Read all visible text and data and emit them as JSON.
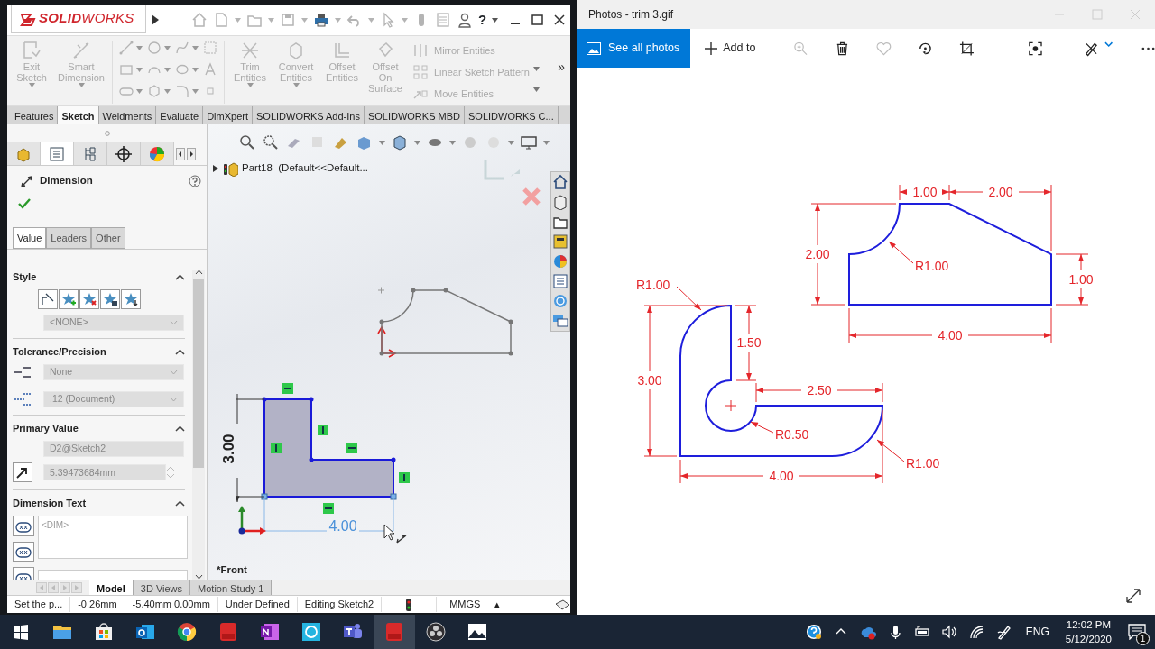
{
  "solidworks": {
    "logo": "**SOLID**WORKS",
    "help": "?",
    "left_commands": [
      {
        "label": "Exit Sketch",
        "disabled": true
      },
      {
        "label": "Smart Dimension",
        "disabled": true
      }
    ],
    "right_commands": [
      {
        "label": "Trim Entities",
        "disabled": true
      },
      {
        "label": "Convert Entities",
        "disabled": true
      },
      {
        "label": "Offset Entities",
        "disabled": true
      },
      {
        "label": "Offset On Surface",
        "disabled": true
      }
    ],
    "list_commands": [
      {
        "label": "Mirror Entities",
        "disabled": true
      },
      {
        "label": "Linear Sketch Pattern",
        "disabled": true
      },
      {
        "label": "Move Entities",
        "disabled": true
      }
    ],
    "more": "»",
    "ribbon_tabs": [
      {
        "label": "Features",
        "selected": false
      },
      {
        "label": "Sketch",
        "selected": true
      },
      {
        "label": "Weldments",
        "selected": false
      },
      {
        "label": "Evaluate",
        "selected": false
      },
      {
        "label": "DimXpert",
        "selected": false
      },
      {
        "label": "SOLIDWORKS Add-Ins",
        "selected": false
      },
      {
        "label": "SOLIDWORKS MBD",
        "selected": false
      },
      {
        "label": "SOLIDWORKS C...",
        "selected": false
      }
    ],
    "panel_tabs": [
      {
        "kind": "feature-tree",
        "selected": false
      },
      {
        "kind": "properties",
        "selected": true
      },
      {
        "kind": "configurations",
        "selected": false
      },
      {
        "kind": "dimxpert",
        "selected": false
      },
      {
        "kind": "appearance",
        "selected": false
      }
    ],
    "manager": {
      "title": "Dimension",
      "tabs": [
        {
          "label": "Value",
          "selected": true
        },
        {
          "label": "Leaders",
          "selected": false
        },
        {
          "label": "Other",
          "selected": false
        }
      ],
      "style": {
        "heading": "Style",
        "dropdown": "<NONE>"
      },
      "tolerance": {
        "heading": "Tolerance/Precision",
        "tolerance": "None",
        "precision": ".12 (Document)"
      },
      "primary": {
        "heading": "Primary Value",
        "name": "D2@Sketch2",
        "value": "5.39473684mm"
      },
      "text": {
        "heading": "Dimension Text",
        "template": "<DIM>"
      }
    },
    "tree_item": "Part18  (Default<<Default...",
    "sketch_dimensions": [
      "3.00",
      "4.00"
    ],
    "view_name": "*Front",
    "bottom_tabs": [
      {
        "label": "Model",
        "selected": true
      },
      {
        "label": "3D Views",
        "selected": false
      },
      {
        "label": "Motion Study 1",
        "selected": false
      }
    ],
    "status": [
      "Set the p...",
      "-0.26mm",
      "-5.40mm  0.00mm",
      "Under Defined",
      "Editing Sketch2",
      "MMGS",
      "▴"
    ]
  },
  "photos": {
    "title": "Photos - trim 3.gif",
    "see_all": "See all photos",
    "add_to": "Add to",
    "tools": [
      {
        "kind": "zoom",
        "disabled": true
      },
      {
        "kind": "delete",
        "disabled": false
      },
      {
        "kind": "favorite",
        "disabled": true
      },
      {
        "kind": "rotate",
        "disabled": false
      },
      {
        "kind": "crop",
        "disabled": false
      },
      {
        "kind": "capture",
        "disabled": false
      },
      {
        "kind": "edit",
        "disabled": false
      }
    ],
    "drawing_labels": [
      "1.00",
      "2.00",
      "2.00",
      "R1.00",
      "1.00",
      "4.00",
      "R1.00",
      "1.50",
      "3.00",
      "2.50",
      "R0.50",
      "R1.00",
      "4.00"
    ]
  },
  "taskbar": {
    "apps": [
      {
        "kind": "explorer",
        "active": false
      },
      {
        "kind": "store",
        "active": false
      },
      {
        "kind": "mail",
        "active": false
      },
      {
        "kind": "browser",
        "active": false
      },
      {
        "kind": "cad",
        "active": false
      },
      {
        "kind": "notes",
        "active": false
      },
      {
        "kind": "chat",
        "active": false
      },
      {
        "kind": "teams",
        "active": false
      },
      {
        "kind": "cad",
        "active": true
      },
      {
        "kind": "recorder",
        "active": false
      },
      {
        "kind": "photos",
        "active": false
      }
    ],
    "language": "ENG",
    "time": "12:02 PM",
    "date": "5/12/2020",
    "notifications": "1"
  }
}
